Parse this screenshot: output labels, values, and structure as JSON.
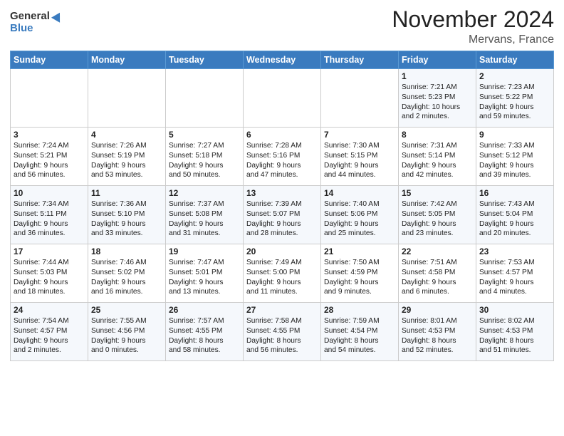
{
  "logo": {
    "general": "General",
    "blue": "Blue"
  },
  "title": "November 2024",
  "subtitle": "Mervans, France",
  "days_of_week": [
    "Sunday",
    "Monday",
    "Tuesday",
    "Wednesday",
    "Thursday",
    "Friday",
    "Saturday"
  ],
  "weeks": [
    [
      {
        "day": "",
        "info": ""
      },
      {
        "day": "",
        "info": ""
      },
      {
        "day": "",
        "info": ""
      },
      {
        "day": "",
        "info": ""
      },
      {
        "day": "",
        "info": ""
      },
      {
        "day": "1",
        "info": "Sunrise: 7:21 AM\nSunset: 5:23 PM\nDaylight: 10 hours\nand 2 minutes."
      },
      {
        "day": "2",
        "info": "Sunrise: 7:23 AM\nSunset: 5:22 PM\nDaylight: 9 hours\nand 59 minutes."
      }
    ],
    [
      {
        "day": "3",
        "info": "Sunrise: 7:24 AM\nSunset: 5:21 PM\nDaylight: 9 hours\nand 56 minutes."
      },
      {
        "day": "4",
        "info": "Sunrise: 7:26 AM\nSunset: 5:19 PM\nDaylight: 9 hours\nand 53 minutes."
      },
      {
        "day": "5",
        "info": "Sunrise: 7:27 AM\nSunset: 5:18 PM\nDaylight: 9 hours\nand 50 minutes."
      },
      {
        "day": "6",
        "info": "Sunrise: 7:28 AM\nSunset: 5:16 PM\nDaylight: 9 hours\nand 47 minutes."
      },
      {
        "day": "7",
        "info": "Sunrise: 7:30 AM\nSunset: 5:15 PM\nDaylight: 9 hours\nand 44 minutes."
      },
      {
        "day": "8",
        "info": "Sunrise: 7:31 AM\nSunset: 5:14 PM\nDaylight: 9 hours\nand 42 minutes."
      },
      {
        "day": "9",
        "info": "Sunrise: 7:33 AM\nSunset: 5:12 PM\nDaylight: 9 hours\nand 39 minutes."
      }
    ],
    [
      {
        "day": "10",
        "info": "Sunrise: 7:34 AM\nSunset: 5:11 PM\nDaylight: 9 hours\nand 36 minutes."
      },
      {
        "day": "11",
        "info": "Sunrise: 7:36 AM\nSunset: 5:10 PM\nDaylight: 9 hours\nand 33 minutes."
      },
      {
        "day": "12",
        "info": "Sunrise: 7:37 AM\nSunset: 5:08 PM\nDaylight: 9 hours\nand 31 minutes."
      },
      {
        "day": "13",
        "info": "Sunrise: 7:39 AM\nSunset: 5:07 PM\nDaylight: 9 hours\nand 28 minutes."
      },
      {
        "day": "14",
        "info": "Sunrise: 7:40 AM\nSunset: 5:06 PM\nDaylight: 9 hours\nand 25 minutes."
      },
      {
        "day": "15",
        "info": "Sunrise: 7:42 AM\nSunset: 5:05 PM\nDaylight: 9 hours\nand 23 minutes."
      },
      {
        "day": "16",
        "info": "Sunrise: 7:43 AM\nSunset: 5:04 PM\nDaylight: 9 hours\nand 20 minutes."
      }
    ],
    [
      {
        "day": "17",
        "info": "Sunrise: 7:44 AM\nSunset: 5:03 PM\nDaylight: 9 hours\nand 18 minutes."
      },
      {
        "day": "18",
        "info": "Sunrise: 7:46 AM\nSunset: 5:02 PM\nDaylight: 9 hours\nand 16 minutes."
      },
      {
        "day": "19",
        "info": "Sunrise: 7:47 AM\nSunset: 5:01 PM\nDaylight: 9 hours\nand 13 minutes."
      },
      {
        "day": "20",
        "info": "Sunrise: 7:49 AM\nSunset: 5:00 PM\nDaylight: 9 hours\nand 11 minutes."
      },
      {
        "day": "21",
        "info": "Sunrise: 7:50 AM\nSunset: 4:59 PM\nDaylight: 9 hours\nand 9 minutes."
      },
      {
        "day": "22",
        "info": "Sunrise: 7:51 AM\nSunset: 4:58 PM\nDaylight: 9 hours\nand 6 minutes."
      },
      {
        "day": "23",
        "info": "Sunrise: 7:53 AM\nSunset: 4:57 PM\nDaylight: 9 hours\nand 4 minutes."
      }
    ],
    [
      {
        "day": "24",
        "info": "Sunrise: 7:54 AM\nSunset: 4:57 PM\nDaylight: 9 hours\nand 2 minutes."
      },
      {
        "day": "25",
        "info": "Sunrise: 7:55 AM\nSunset: 4:56 PM\nDaylight: 9 hours\nand 0 minutes."
      },
      {
        "day": "26",
        "info": "Sunrise: 7:57 AM\nSunset: 4:55 PM\nDaylight: 8 hours\nand 58 minutes."
      },
      {
        "day": "27",
        "info": "Sunrise: 7:58 AM\nSunset: 4:55 PM\nDaylight: 8 hours\nand 56 minutes."
      },
      {
        "day": "28",
        "info": "Sunrise: 7:59 AM\nSunset: 4:54 PM\nDaylight: 8 hours\nand 54 minutes."
      },
      {
        "day": "29",
        "info": "Sunrise: 8:01 AM\nSunset: 4:53 PM\nDaylight: 8 hours\nand 52 minutes."
      },
      {
        "day": "30",
        "info": "Sunrise: 8:02 AM\nSunset: 4:53 PM\nDaylight: 8 hours\nand 51 minutes."
      }
    ]
  ]
}
